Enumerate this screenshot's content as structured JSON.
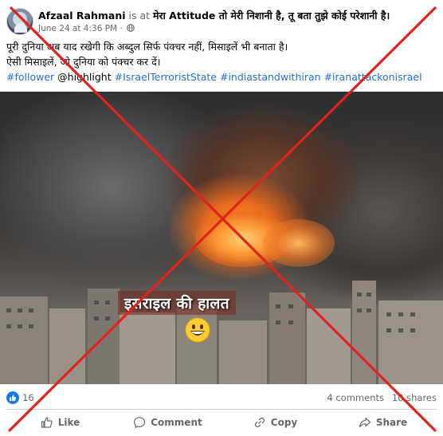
{
  "post": {
    "author": "Afzaal Rahmani",
    "is_at": "is at",
    "place": "मेरा Attitude तो मेरी निशानी है, तू बता तुझे कोई परेशानी है।",
    "timestamp": "June 24 at 4:36 PM",
    "separator": "·",
    "visibility_icon": "globe-icon",
    "text_line1": "पूरी दुनिया अब याद रखेगी कि अब्दुल सिर्फ पंक्चर नहीं, मिसाइलें भी बनाता है।",
    "text_line2": "ऐसी मिसाइलें, जो दुनिया को पंक्चर कर दें।",
    "hashtags": [
      "#follower",
      "@highlight",
      "#IsraelTerroristState",
      "#indiastandwithiran",
      "#iranattackonisrael"
    ],
    "image_caption": "इसराइल की हालत",
    "image_emoji": "grinning-face-emoji"
  },
  "stats": {
    "reaction_count": "16",
    "comments": "4 comments",
    "shares": "10 shares"
  },
  "actions": {
    "like": "Like",
    "comment": "Comment",
    "copy": "Copy",
    "share": "Share"
  },
  "colors": {
    "link": "#216fdb",
    "secondary_text": "#65676b",
    "like_blue": "#1877f2",
    "cross_red": "#e0241b"
  }
}
